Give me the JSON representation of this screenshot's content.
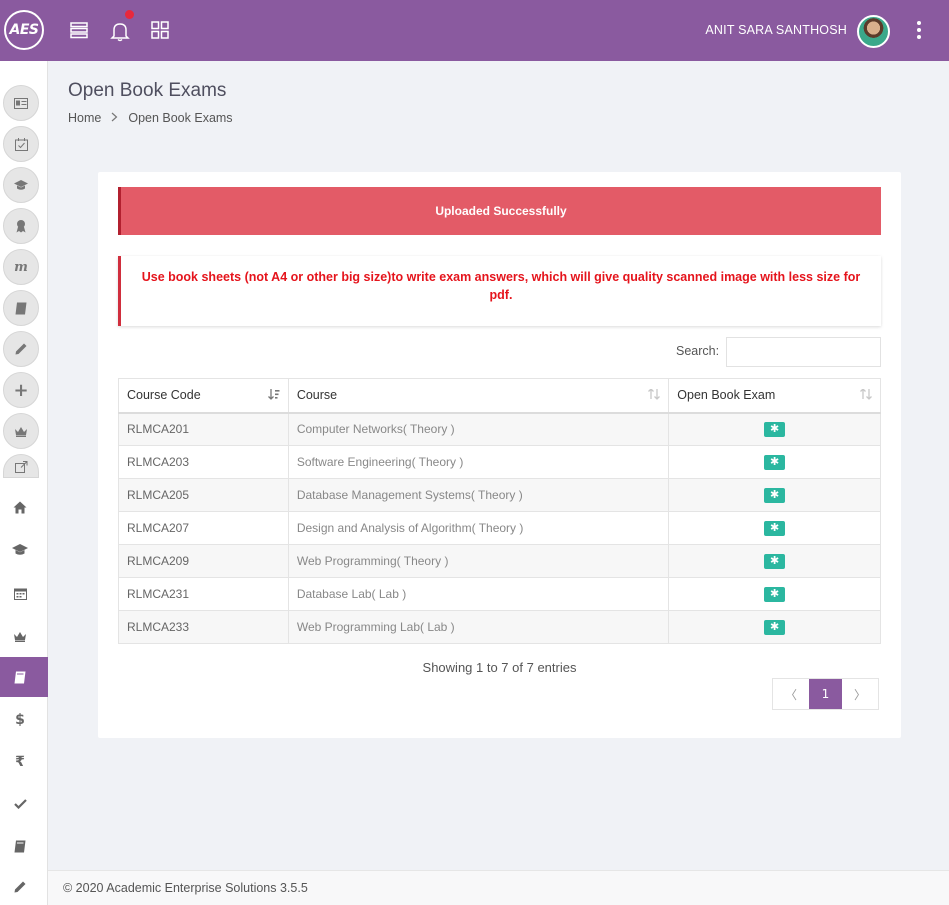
{
  "header": {
    "logo_text": "AES",
    "user_name": "ANIT SARA SANTHOSH",
    "icons": [
      "list-icon",
      "bell-icon",
      "grid-icon",
      "more-vertical-icon"
    ]
  },
  "sidebar": {
    "circle_icons": [
      "id-card-icon",
      "calendar-check-icon",
      "graduation-cap-icon",
      "award-icon",
      "m-icon",
      "book-icon",
      "pencil-icon",
      "plus-icon",
      "crown-icon",
      "external-link-icon"
    ],
    "plain_icons": [
      "home-icon",
      "graduation-cap-icon",
      "calendar-icon",
      "crown-icon",
      "book-icon",
      "dollar-icon",
      "rupee-icon",
      "check-icon",
      "book-icon",
      "pencil-icon"
    ],
    "active_item": "book-icon"
  },
  "page": {
    "title": "Open Book Exams",
    "breadcrumb_home": "Home",
    "breadcrumb_current": "Open Book Exams"
  },
  "alerts": {
    "success": "Uploaded Successfully",
    "note": "Use book sheets (not A4 or other big size)to write exam answers, which will give quality scanned image with less size for pdf."
  },
  "search": {
    "label": "Search:",
    "value": ""
  },
  "table": {
    "headers": [
      "Course Code",
      "Course",
      "Open Book Exam"
    ],
    "rows": [
      {
        "code": "RLMCA201",
        "course": "Computer Networks( Theory )"
      },
      {
        "code": "RLMCA203",
        "course": "Software Engineering( Theory )"
      },
      {
        "code": "RLMCA205",
        "course": "Database Management Systems( Theory )"
      },
      {
        "code": "RLMCA207",
        "course": "Design and Analysis of Algorithm( Theory )"
      },
      {
        "code": "RLMCA209",
        "course": "Web Programming( Theory )"
      },
      {
        "code": "RLMCA231",
        "course": "Database Lab( Lab )"
      },
      {
        "code": "RLMCA233",
        "course": "Web Programming Lab( Lab )"
      }
    ]
  },
  "pagination": {
    "info": "Showing 1 to 7 of 7 entries",
    "prev": "〈",
    "current": "1",
    "next": "〉"
  },
  "footer": {
    "text": "© 2020 Academic Enterprise Solutions 3.5.5"
  },
  "colors": {
    "brand": "#8a5a9f",
    "success_alert": "#e35b67",
    "note_text": "#e5141c",
    "action_button": "#2bb7a0"
  }
}
